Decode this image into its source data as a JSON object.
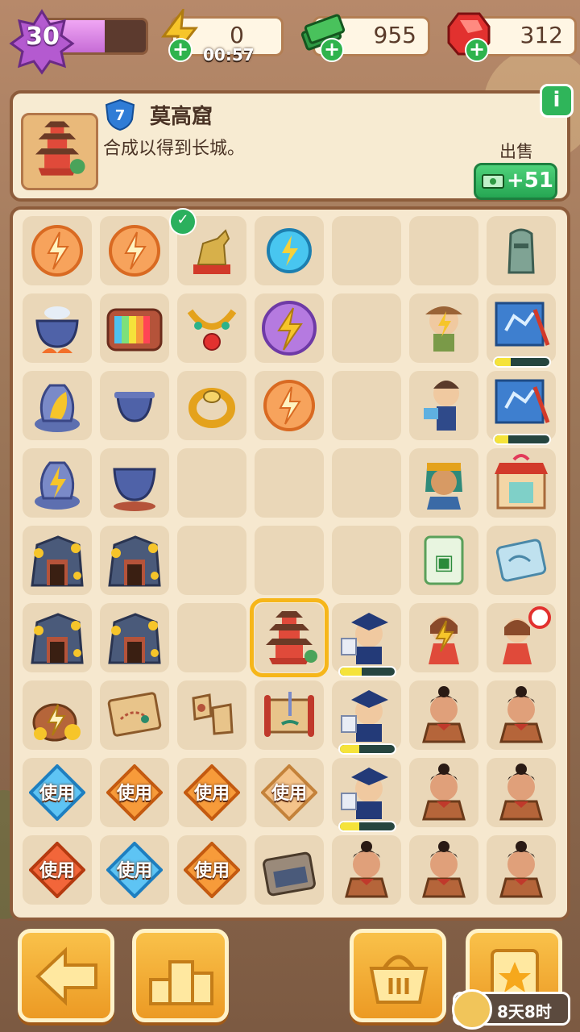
{
  "level": {
    "value": "30",
    "progress": 0.6
  },
  "resources": {
    "energy": {
      "value": "0",
      "timer": "00:57",
      "icon": "lightning-icon"
    },
    "cash": {
      "value": "955",
      "icon": "cash-stack-icon"
    },
    "gems": {
      "value": "312",
      "icon": "red-gem-icon"
    }
  },
  "info": {
    "item_level": "7",
    "title": "莫高窟",
    "description": "合成以得到长城。",
    "sell_label": "出售",
    "sell_price": "+51",
    "info_button": "i"
  },
  "board": {
    "use_label": "使用",
    "cells": [
      {
        "r": 0,
        "c": 0,
        "item": "energy-orb-orange-icon"
      },
      {
        "r": 0,
        "c": 1,
        "item": "energy-orb-orange-icon"
      },
      {
        "r": 0,
        "c": 2,
        "item": "golden-horse-statue-icon",
        "check": true
      },
      {
        "r": 0,
        "c": 3,
        "item": "energy-orb-blue-icon"
      },
      {
        "r": 0,
        "c": 4,
        "item": ""
      },
      {
        "r": 0,
        "c": 5,
        "item": ""
      },
      {
        "r": 0,
        "c": 6,
        "item": "moai-statue-icon"
      },
      {
        "r": 1,
        "c": 0,
        "item": "cauldron-fire-icon"
      },
      {
        "r": 1,
        "c": 1,
        "item": "retro-tv-icon"
      },
      {
        "r": 1,
        "c": 2,
        "item": "jeweled-necklace-icon"
      },
      {
        "r": 1,
        "c": 3,
        "item": "energy-orb-purple-icon"
      },
      {
        "r": 1,
        "c": 4,
        "item": ""
      },
      {
        "r": 1,
        "c": 5,
        "item": "explorer-energy-icon"
      },
      {
        "r": 1,
        "c": 6,
        "item": "blueprint-icon",
        "progress": 0.3
      },
      {
        "r": 2,
        "c": 0,
        "item": "golden-vase-icon"
      },
      {
        "r": 2,
        "c": 1,
        "item": "small-cauldron-icon"
      },
      {
        "r": 2,
        "c": 2,
        "item": "gold-ring-icon"
      },
      {
        "r": 2,
        "c": 3,
        "item": "energy-orb-orange-icon"
      },
      {
        "r": 2,
        "c": 4,
        "item": ""
      },
      {
        "r": 2,
        "c": 5,
        "item": "reading-scholar-icon"
      },
      {
        "r": 2,
        "c": 6,
        "item": "blueprint-icon",
        "progress": 0.25
      },
      {
        "r": 3,
        "c": 0,
        "item": "golden-vase-energy-icon"
      },
      {
        "r": 3,
        "c": 1,
        "item": "cauldron-icon"
      },
      {
        "r": 3,
        "c": 2,
        "item": ""
      },
      {
        "r": 3,
        "c": 3,
        "item": ""
      },
      {
        "r": 3,
        "c": 4,
        "item": ""
      },
      {
        "r": 3,
        "c": 5,
        "item": "pharaoh-bust-icon"
      },
      {
        "r": 3,
        "c": 6,
        "item": "gift-shop-icon"
      },
      {
        "r": 4,
        "c": 0,
        "item": "gold-mine-icon"
      },
      {
        "r": 4,
        "c": 1,
        "item": "gold-mine-icon"
      },
      {
        "r": 4,
        "c": 2,
        "item": ""
      },
      {
        "r": 4,
        "c": 3,
        "item": ""
      },
      {
        "r": 4,
        "c": 4,
        "item": ""
      },
      {
        "r": 4,
        "c": 5,
        "item": "mahjong-tile-icon"
      },
      {
        "r": 4,
        "c": 6,
        "item": "scroll-map-icon"
      },
      {
        "r": 5,
        "c": 0,
        "item": "gold-mine-icon"
      },
      {
        "r": 5,
        "c": 1,
        "item": "gold-mine-icon"
      },
      {
        "r": 5,
        "c": 2,
        "item": ""
      },
      {
        "r": 5,
        "c": 3,
        "item": "pagoda-icon",
        "selected": true
      },
      {
        "r": 5,
        "c": 4,
        "item": "graduate-icon",
        "progress": 0.4
      },
      {
        "r": 5,
        "c": 5,
        "item": "girl-energy-icon"
      },
      {
        "r": 5,
        "c": 6,
        "item": "guide-girl-icon"
      },
      {
        "r": 6,
        "c": 0,
        "item": "treasure-pot-energy-icon"
      },
      {
        "r": 6,
        "c": 1,
        "item": "treasure-map-icon"
      },
      {
        "r": 6,
        "c": 2,
        "item": "map-fragments-icon"
      },
      {
        "r": 6,
        "c": 3,
        "item": "scroll-dagger-icon"
      },
      {
        "r": 6,
        "c": 4,
        "item": "graduate-icon",
        "progress": 0.35
      },
      {
        "r": 6,
        "c": 5,
        "item": "terracotta-warrior-icon"
      },
      {
        "r": 6,
        "c": 6,
        "item": "terracotta-warrior-icon"
      },
      {
        "r": 7,
        "c": 0,
        "item": "use-blue-icon",
        "use": true
      },
      {
        "r": 7,
        "c": 1,
        "item": "use-orange-icon",
        "use": true
      },
      {
        "r": 7,
        "c": 2,
        "item": "use-orange-icon",
        "use": true
      },
      {
        "r": 7,
        "c": 3,
        "item": "use-peach-icon",
        "use": true
      },
      {
        "r": 7,
        "c": 4,
        "item": "graduate-icon",
        "progress": 0.35
      },
      {
        "r": 7,
        "c": 5,
        "item": "terracotta-warrior-icon"
      },
      {
        "r": 7,
        "c": 6,
        "item": "terracotta-warrior-icon"
      },
      {
        "r": 8,
        "c": 0,
        "item": "use-red-icon",
        "use": true
      },
      {
        "r": 8,
        "c": 1,
        "item": "use-blue-icon",
        "use": true
      },
      {
        "r": 8,
        "c": 2,
        "item": "use-orange-icon",
        "use": true
      },
      {
        "r": 8,
        "c": 3,
        "item": "suitcase-icon"
      },
      {
        "r": 8,
        "c": 4,
        "item": "terracotta-warrior-icon"
      },
      {
        "r": 8,
        "c": 5,
        "item": "terracotta-warrior-icon"
      },
      {
        "r": 8,
        "c": 6,
        "item": "terracotta-warrior-icon"
      }
    ]
  },
  "bottom": {
    "back_icon": "arrow-left-icon",
    "leaderboard_icon": "podium-icon",
    "shop_icon": "basket-icon",
    "tasks_icon": "star-clipboard-icon",
    "event_timer": "8天8时"
  },
  "colors": {
    "accent_orange": "#f0a830",
    "sell_green": "#25a653",
    "level_purple": "#c66cd6"
  }
}
